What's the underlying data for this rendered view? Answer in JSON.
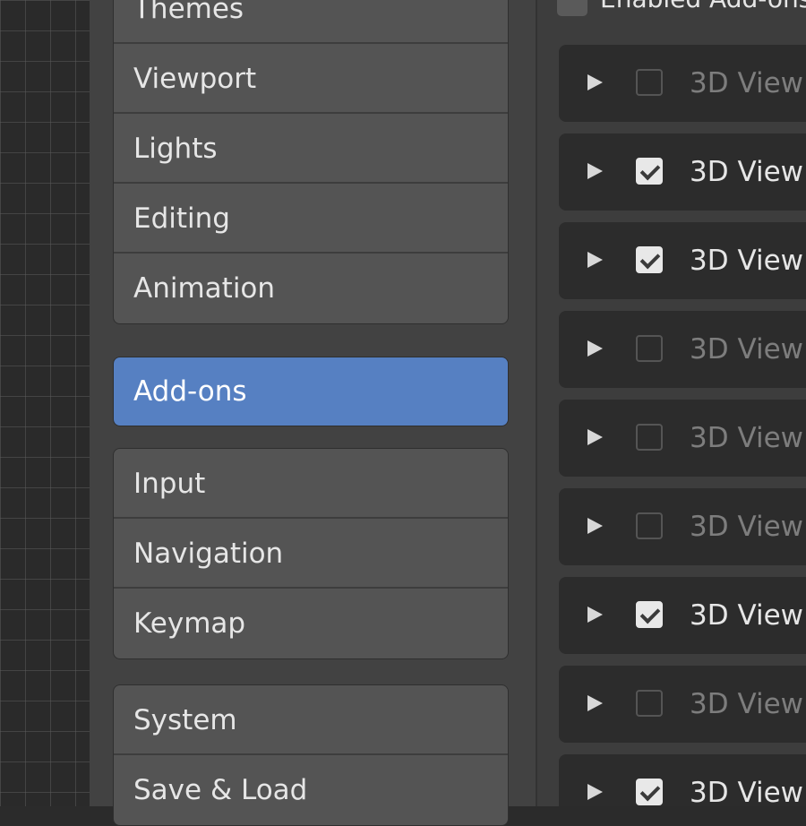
{
  "nav": {
    "group1": [
      "Themes",
      "Viewport",
      "Lights",
      "Editing",
      "Animation"
    ],
    "active": "Add-ons",
    "group2": [
      "Input",
      "Navigation",
      "Keymap"
    ],
    "group3": [
      "System",
      "Save & Load"
    ]
  },
  "addons": {
    "filter_label": "Enabled Add-ons",
    "filter_checked": false,
    "rows": [
      {
        "name": "3D View",
        "enabled": false
      },
      {
        "name": "3D View",
        "enabled": true
      },
      {
        "name": "3D View",
        "enabled": true
      },
      {
        "name": "3D View",
        "enabled": false
      },
      {
        "name": "3D View",
        "enabled": false
      },
      {
        "name": "3D View",
        "enabled": false
      },
      {
        "name": "3D View",
        "enabled": true
      },
      {
        "name": "3D View",
        "enabled": false
      },
      {
        "name": "3D View",
        "enabled": true
      }
    ]
  },
  "colors": {
    "accent": "#5680c2",
    "panel": "#424242",
    "button": "#545454"
  },
  "icons": {
    "expand": "disclosure-triangle-right",
    "checkbox": "checkbox"
  }
}
